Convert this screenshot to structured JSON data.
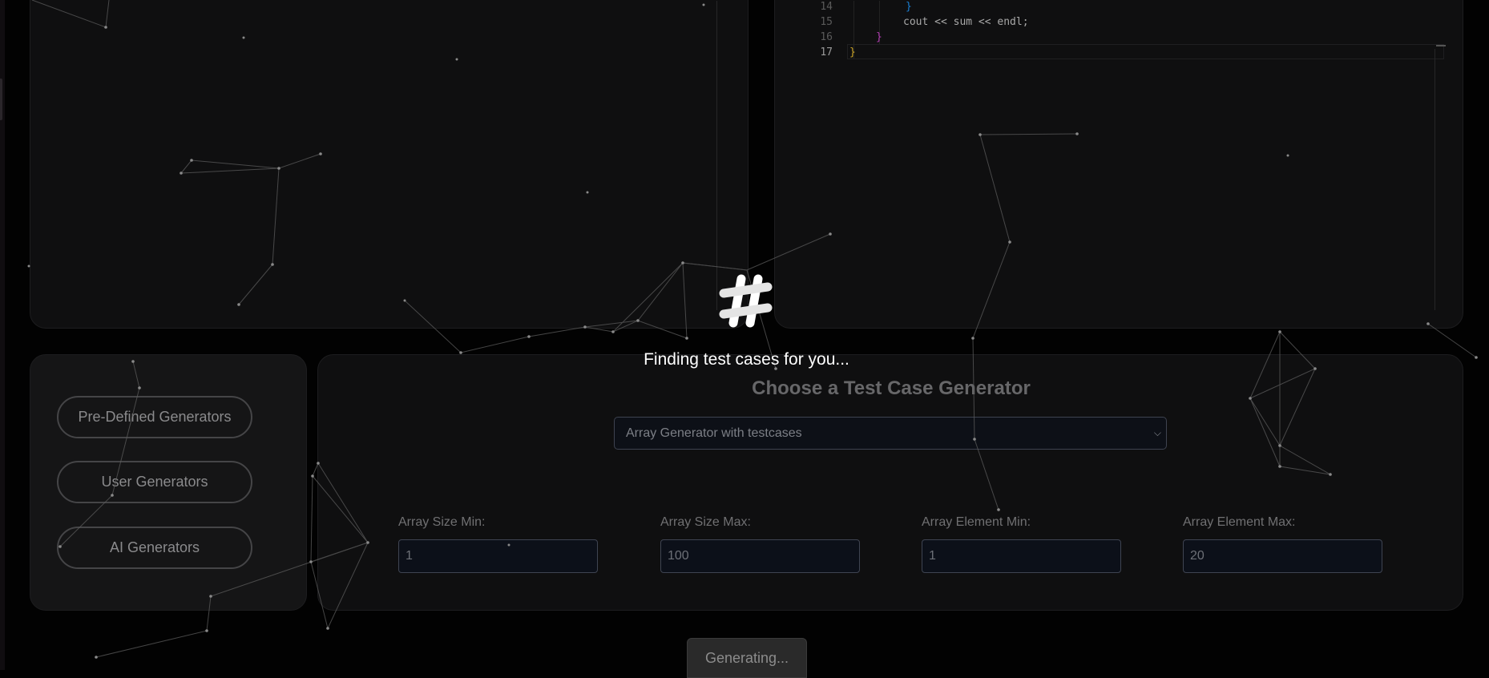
{
  "editor": {
    "lines": [
      {
        "number": "14",
        "text": "}",
        "color": "#1a7fd4",
        "indent": 1
      },
      {
        "number": "15",
        "text": "cout << sum << endl;",
        "color": "#a8a8a8",
        "indent": 1
      },
      {
        "number": "16",
        "text": "}",
        "color": "#b03bb0",
        "indent": 2
      },
      {
        "number": "17",
        "text": "}",
        "color": "#c9a227",
        "indent": 3
      }
    ]
  },
  "sidebar": {
    "buttons": [
      {
        "label": "Pre-Defined Generators"
      },
      {
        "label": "User Generators"
      },
      {
        "label": "AI Generators"
      }
    ]
  },
  "generator": {
    "title": "Choose a Test Case Generator",
    "selected": "Array Generator with testcases",
    "fields": [
      {
        "label": "Array Size Min:",
        "value": "1"
      },
      {
        "label": "Array Size Max:",
        "value": "100"
      },
      {
        "label": "Array Element Min:",
        "value": "1"
      },
      {
        "label": "Array Element Max:",
        "value": "20"
      }
    ]
  },
  "action": {
    "generate_label": "Generating..."
  },
  "loading": {
    "message": "Finding test cases for you...",
    "icon": "hash-icon"
  },
  "colors": {
    "background": "#020202",
    "panel": "#0f0f10",
    "accent_white": "#ffffff"
  }
}
